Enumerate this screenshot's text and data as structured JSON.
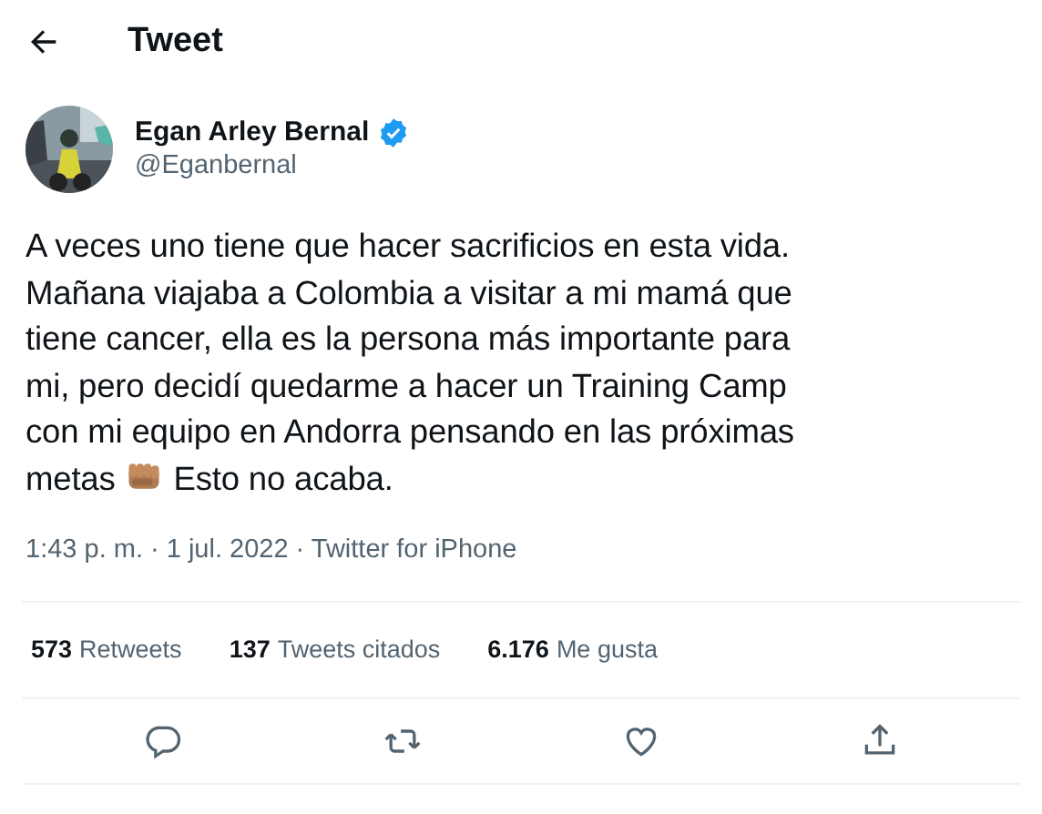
{
  "header": {
    "title": "Tweet"
  },
  "author": {
    "name": "Egan Arley Bernal",
    "verified": true,
    "handle": "@Eganbernal"
  },
  "body": {
    "lines": [
      "A veces uno tiene que hacer sacrificios en esta vida.",
      "Mañana viajaba a Colombia a visitar a mi mamá que",
      "tiene cancer, ella es la persona más importante para",
      "mi, pero decidí quedarme a hacer un Training Camp",
      "con mi equipo en Andorra pensando en las próximas"
    ],
    "last_line": {
      "before_emoji": "metas",
      "after_emoji": "Esto no acaba."
    }
  },
  "meta": "1:43 p. m. · 1 jul. 2022 · Twitter for iPhone",
  "stats": [
    {
      "count": "573",
      "label": "Retweets"
    },
    {
      "count": "137",
      "label": "Tweets citados"
    },
    {
      "count": "6.176",
      "label": "Me gusta"
    }
  ],
  "actions": [
    {
      "kind": "reply"
    },
    {
      "kind": "retweet"
    },
    {
      "kind": "like"
    },
    {
      "kind": "share"
    }
  ]
}
